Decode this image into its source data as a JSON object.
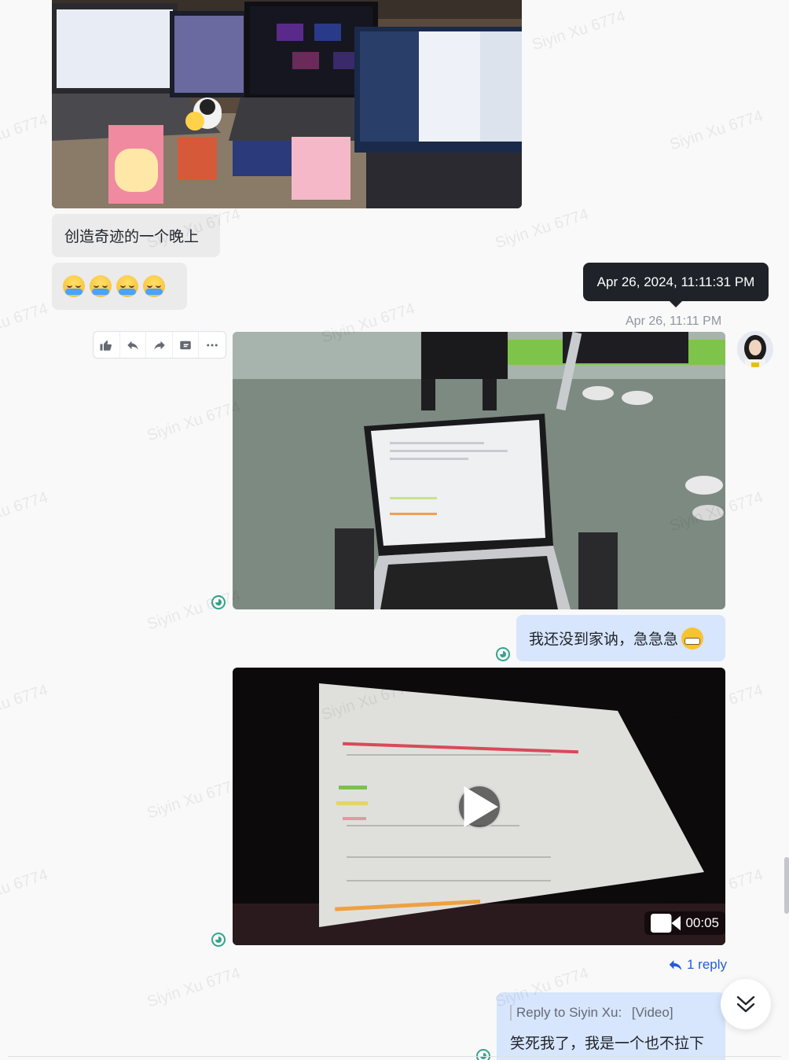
{
  "watermark": "Siyin Xu 6774",
  "messages": {
    "m1_text": "创造奇迹的一个晚上",
    "m2_emoji_count": 4,
    "m3_text": "我还没到家讷，急急急",
    "reply": {
      "label": "Reply to Siyin Xu:",
      "quoted": "[Video]",
      "text": "笑死我了，我是一个也不拉下"
    }
  },
  "tooltip": "Apr 26, 2024, 11:11:31 PM",
  "timestamp": "Apr 26, 11:11 PM",
  "video": {
    "duration": "00:05"
  },
  "thread": {
    "reply_count": "1 reply"
  },
  "colors": {
    "accent": "#245bdb",
    "bubble_out": "#d7e5fd",
    "bubble_in": "#ebebeb",
    "read_status": "#34a48b"
  }
}
